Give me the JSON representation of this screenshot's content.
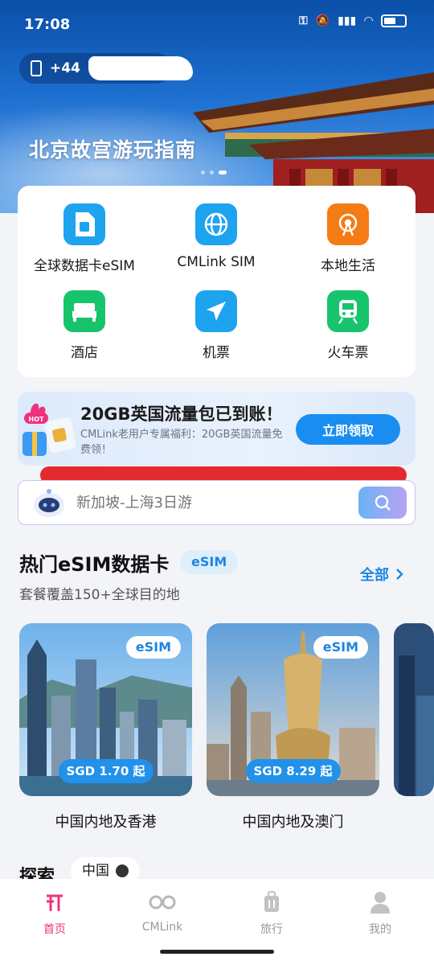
{
  "status": {
    "time": "17:08"
  },
  "hero": {
    "phone": "+44",
    "title": "北京故宫游玩指南"
  },
  "services": [
    {
      "label": "全球数据卡eSIM",
      "icon": "esim-card-icon"
    },
    {
      "label": "CMLink SIM",
      "icon": "globe-icon"
    },
    {
      "label": "本地生活",
      "icon": "ferris-wheel-icon"
    },
    {
      "label": "酒店",
      "icon": "bed-icon"
    },
    {
      "label": "机票",
      "icon": "airplane-icon"
    },
    {
      "label": "火车票",
      "icon": "train-icon"
    }
  ],
  "promo": {
    "badge": "HOT",
    "title": "20GB英国流量包已到账！",
    "desc": "CMLink老用户专属福利：20GB英国流量免费领！",
    "button": "立即领取"
  },
  "search": {
    "placeholder": "新加坡-上海3日游"
  },
  "section": {
    "title": "热门eSIM数据卡",
    "badge": "eSIM",
    "all": "全部",
    "subtitle": "套餐覆盖150+全球目的地"
  },
  "cards": [
    {
      "badge": "eSIM",
      "price": "SGD 1.70 起",
      "name": "中国内地及香港"
    },
    {
      "badge": "eSIM",
      "price": "SGD 8.29 起",
      "name": "中国内地及澳门"
    }
  ],
  "explore": {
    "title": "探索",
    "chip": "中国"
  },
  "tabs": [
    {
      "label": "首页",
      "active": true
    },
    {
      "label": "CMLink",
      "active": false
    },
    {
      "label": "旅行",
      "active": false
    },
    {
      "label": "我的",
      "active": false
    }
  ],
  "colors": {
    "accent": "#1e86e0",
    "tab_active": "#f0317f",
    "promo_button": "#1a8ef0",
    "redaction": "#e52a2f"
  }
}
